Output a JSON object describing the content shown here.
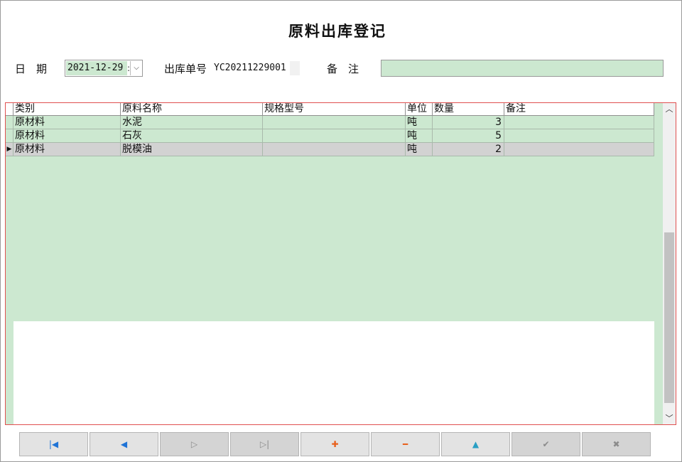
{
  "window": {
    "title": "原料出库登记"
  },
  "form": {
    "date_label": "日　期",
    "date_value": "2021-12-29",
    "order_label": "出库单号",
    "order_no": "YC20211229001",
    "remark_label": "备　注",
    "remark_value": ""
  },
  "grid": {
    "columns": [
      "类别",
      "原料名称",
      "规格型号",
      "单位",
      "数量",
      "备注"
    ],
    "rows": [
      {
        "type": "原材料",
        "name": "水泥",
        "spec": "",
        "unit": "吨",
        "qty": "3",
        "remark": ""
      },
      {
        "type": "原材料",
        "name": "石灰",
        "spec": "",
        "unit": "吨",
        "qty": "5",
        "remark": ""
      },
      {
        "type": "原材料",
        "name": "脱模油",
        "spec": "",
        "unit": "吨",
        "qty": "2",
        "remark": ""
      }
    ],
    "current_row_marker": "▶"
  },
  "nav_buttons": [
    {
      "name": "first-record",
      "icon": "|◀",
      "enabled": true
    },
    {
      "name": "prev-record",
      "icon": "◀",
      "enabled": true
    },
    {
      "name": "next-record",
      "icon": "▷",
      "enabled": false
    },
    {
      "name": "last-record",
      "icon": "▷|",
      "enabled": false
    },
    {
      "name": "add-record",
      "icon": "✚",
      "enabled": true
    },
    {
      "name": "delete-record",
      "icon": "━",
      "enabled": true
    },
    {
      "name": "edit-record",
      "icon": "▲",
      "enabled": true
    },
    {
      "name": "confirm",
      "icon": "✔",
      "enabled": false
    },
    {
      "name": "cancel",
      "icon": "✖",
      "enabled": false
    }
  ],
  "colors": {
    "grid_bg": "#cce8d0",
    "grid_border": "#e05050",
    "selected_row": "#d2d2d2"
  }
}
